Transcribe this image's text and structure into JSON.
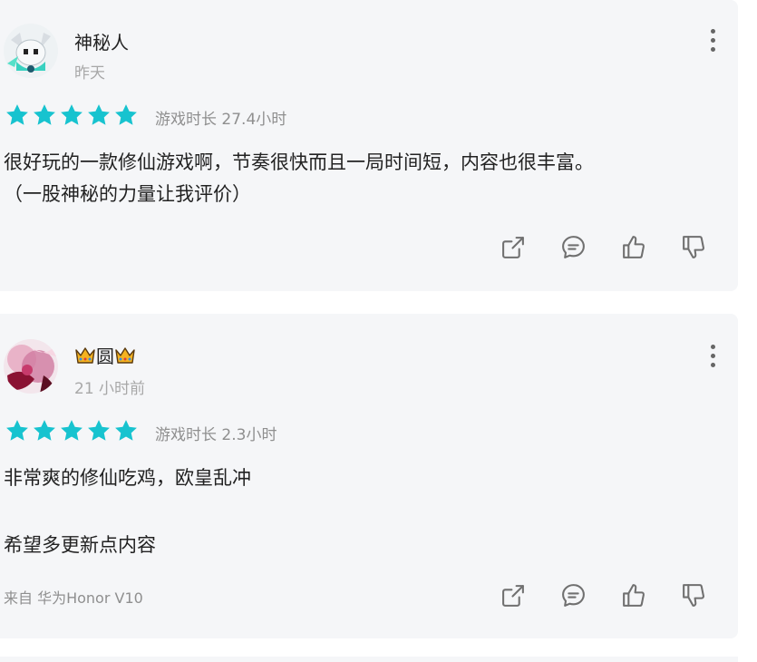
{
  "reviews": [
    {
      "username": "神秘人",
      "time": "昨天",
      "rating": 5,
      "playtime": "游戏时长 27.4小时",
      "text": "很好玩的一款修仙游戏啊，节奏很快而且一局时间短，内容也很丰富。\n（一股神秘的力量让我评价）",
      "device": ""
    },
    {
      "username": "圆",
      "time": "21 小时前",
      "rating": 5,
      "playtime": "游戏时长 2.3小时",
      "text": "非常爽的修仙吃鸡，欧皇乱冲\n\n希望多更新点内容",
      "device": "来自 华为Honor V10"
    }
  ],
  "icons": {
    "star": "star-icon",
    "share": "share-icon",
    "comment": "comment-icon",
    "like": "thumbs-up-icon",
    "dislike": "thumbs-down-icon",
    "more": "more-vertical-icon",
    "crown": "crown-icon"
  },
  "colors": {
    "star": "#17c3cf",
    "card_bg": "#f5f6f8",
    "icon_stroke": "#707070"
  }
}
